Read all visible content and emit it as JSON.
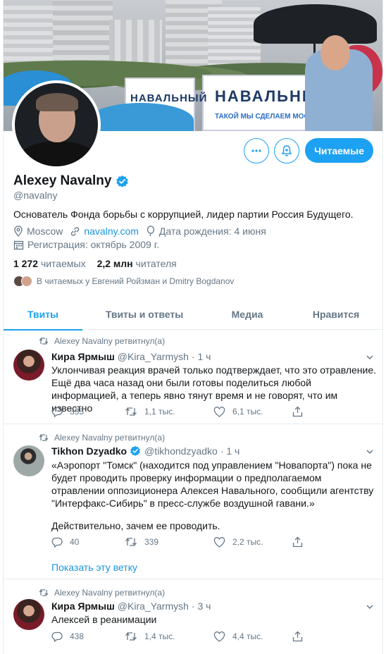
{
  "banner": {
    "sign_left": "НАВАЛЬНЫЙ",
    "sign_right": "НАВАЛЬНЫ",
    "sign_slogan": "ТАКОЙ МЫ СДЕЛАЕМ МОСК"
  },
  "actions": {
    "follow_label": "Читаемые"
  },
  "profile": {
    "name": "Alexey Navalny",
    "handle": "@navalny",
    "bio": "Основатель Фонда борьбы с коррупцией, лидер партии Россия Будущего.",
    "location": "Moscow",
    "website": "navalny.com",
    "birthday": "Дата рождения: 4 июня",
    "joined": "Регистрация: октябрь 2009 г.",
    "following_count": "1 272",
    "following_label": "читаемых",
    "followers_count": "2,2 млн",
    "followers_label": "читателя",
    "followed_by": "В читаемых у Евгений Ройзман и Dmitry Bogdanov"
  },
  "tabs": [
    {
      "label": "Твиты"
    },
    {
      "label": "Твиты и ответы"
    },
    {
      "label": "Медиа"
    },
    {
      "label": "Нравится"
    }
  ],
  "tweets": [
    {
      "retweet_label": "Alexey Navalny ретвитнул(а)",
      "author": "Кира Ярмыш",
      "handle": "@Kira_Yarmysh",
      "time": "· 1 ч",
      "text": "Уклончивая реакция врачей только подтверждает, что это отравление. Ещё два часа назад они были готовы поделиться любой информацией, а теперь явно тянут время и не говорят, что им известно",
      "replies": "335",
      "retweets": "1,1 тыс.",
      "likes": "6,1 тыс."
    },
    {
      "retweet_label": "Alexey Navalny ретвитнул(а)",
      "author": "Tikhon Dzyadko",
      "handle": "@tikhondzyadko",
      "time": "· 1 ч",
      "text": "«Аэропорт \"Томск\" (находится под управлением \"Новапорта\") пока не будет проводить проверку информации о предполагаемом отравлении оппозиционера Алексея Навального, сообщили агентству \"Интерфакс-Сибирь\" в пресс-службе воздушной гавани.»",
      "text2": "Действительно, зачем ее проводить.",
      "replies": "40",
      "retweets": "339",
      "likes": "2,2 тыс.",
      "show_thread": "Показать эту ветку"
    },
    {
      "retweet_label": "Alexey Navalny ретвитнул(а)",
      "author": "Кира Ярмыш",
      "handle": "@Kira_Yarmysh",
      "time": "· 3 ч",
      "text": "Алексей в реанимации",
      "replies": "438",
      "retweets": "1,4 тыс.",
      "likes": "4,4 тыс."
    }
  ],
  "colors": {
    "accent": "#1da1f2",
    "muted": "#657786",
    "link": "#1b95e0"
  }
}
